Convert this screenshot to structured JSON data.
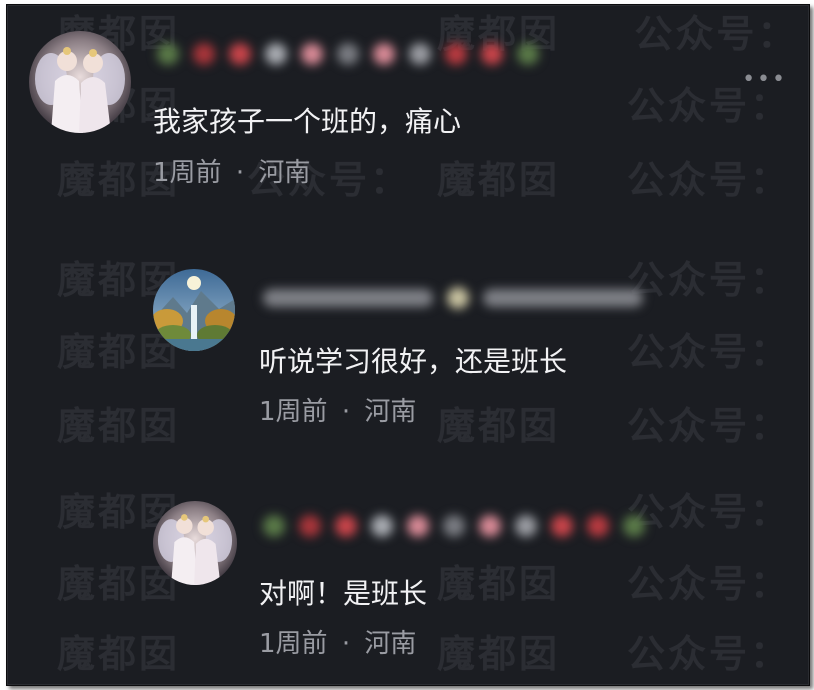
{
  "watermark": "魔都囡 公众号：",
  "comments": [
    {
      "text": "我家孩子一个班的，痛心",
      "time": "1周前",
      "separator": "·",
      "location": "河南",
      "avatar": "fairy-avatar-icon"
    },
    {
      "text": "听说学习很好，还是班长",
      "time": "1周前",
      "separator": "·",
      "location": "河南",
      "avatar": "landscape-avatar-icon"
    },
    {
      "text": "对啊！是班长",
      "time": "1周前",
      "separator": "·",
      "location": "河南",
      "avatar": "fairy-avatar-icon"
    }
  ],
  "more_icon": "more-options-icon",
  "more_glyph": "•••",
  "colors": {
    "background": "#1b1d22",
    "text": "#f2f2f4",
    "meta": "#9a9ca3",
    "watermark": "#2b2d33"
  }
}
